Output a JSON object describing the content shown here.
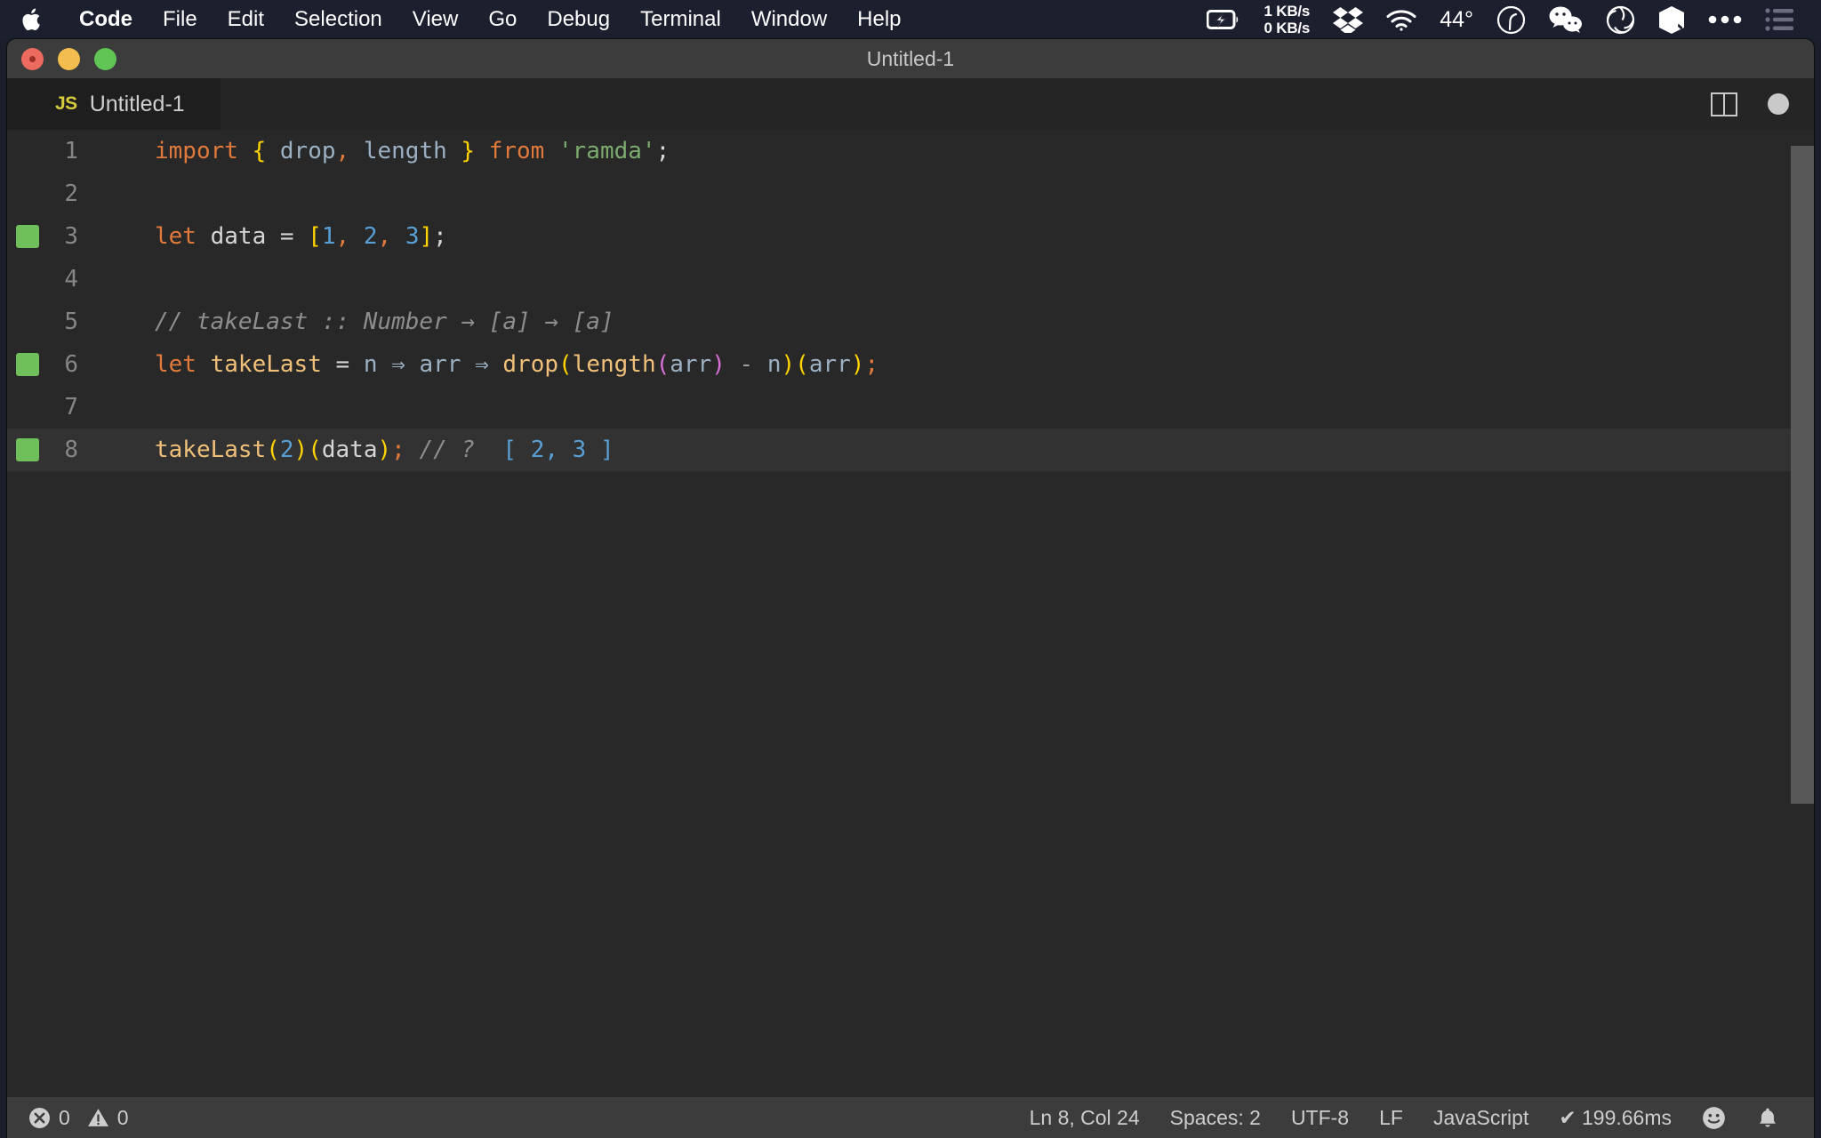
{
  "menubar": {
    "apple_icon": "apple-logo",
    "items": [
      {
        "label": "Code",
        "bold": true
      },
      {
        "label": "File",
        "bold": false
      },
      {
        "label": "Edit",
        "bold": false
      },
      {
        "label": "Selection",
        "bold": false
      },
      {
        "label": "View",
        "bold": false
      },
      {
        "label": "Go",
        "bold": false
      },
      {
        "label": "Debug",
        "bold": false
      },
      {
        "label": "Terminal",
        "bold": false
      },
      {
        "label": "Window",
        "bold": false
      },
      {
        "label": "Help",
        "bold": false
      }
    ],
    "tray": {
      "battery_icon": "battery-charging-icon",
      "network_up": "1 KB/s",
      "network_down": "0 KB/s",
      "dropbox_icon": "dropbox-icon",
      "wifi_icon": "wifi-icon",
      "temperature": "44°",
      "clock_icon": "clock-icon",
      "wechat_icon": "wechat-icon",
      "shutter_icon": "camera-shutter-icon",
      "cube_icon": "cube-icon",
      "overflow_icon": "ellipsis-icon",
      "controlcenter_icon": "list-menu-icon"
    }
  },
  "window": {
    "title": "Untitled-1",
    "traffic": {
      "close": "close-button",
      "minimize": "minimize-button",
      "zoom": "zoom-button"
    }
  },
  "tab": {
    "icon_label": "JS",
    "label": "Untitled-1",
    "split_icon": "split-editor-icon",
    "dirty_icon": "unsaved-dot-icon"
  },
  "editor": {
    "lines": [
      {
        "number": "1",
        "marked": false,
        "active": false,
        "tokens": [
          {
            "t": "import",
            "c": "t-kw"
          },
          {
            "t": " ",
            "c": "t-plain"
          },
          {
            "t": "{",
            "c": "t-brace"
          },
          {
            "t": " ",
            "c": "t-plain"
          },
          {
            "t": "drop",
            "c": "t-var"
          },
          {
            "t": ",",
            "c": "t-comma"
          },
          {
            "t": " ",
            "c": "t-plain"
          },
          {
            "t": "length",
            "c": "t-var"
          },
          {
            "t": " ",
            "c": "t-plain"
          },
          {
            "t": "}",
            "c": "t-brace"
          },
          {
            "t": " ",
            "c": "t-plain"
          },
          {
            "t": "from",
            "c": "t-kw"
          },
          {
            "t": " ",
            "c": "t-plain"
          },
          {
            "t": "'ramda'",
            "c": "t-str"
          },
          {
            "t": ";",
            "c": "t-plain"
          }
        ]
      },
      {
        "number": "2",
        "marked": false,
        "active": false,
        "tokens": []
      },
      {
        "number": "3",
        "marked": true,
        "active": false,
        "tokens": [
          {
            "t": "let",
            "c": "t-kw"
          },
          {
            "t": " ",
            "c": "t-plain"
          },
          {
            "t": "data",
            "c": "t-plain"
          },
          {
            "t": " ",
            "c": "t-plain"
          },
          {
            "t": "=",
            "c": "t-plain"
          },
          {
            "t": " ",
            "c": "t-plain"
          },
          {
            "t": "[",
            "c": "t-brace"
          },
          {
            "t": "1",
            "c": "t-num"
          },
          {
            "t": ",",
            "c": "t-comma"
          },
          {
            "t": " ",
            "c": "t-plain"
          },
          {
            "t": "2",
            "c": "t-num"
          },
          {
            "t": ",",
            "c": "t-comma"
          },
          {
            "t": " ",
            "c": "t-plain"
          },
          {
            "t": "3",
            "c": "t-num"
          },
          {
            "t": "]",
            "c": "t-brace"
          },
          {
            "t": ";",
            "c": "t-plain"
          }
        ]
      },
      {
        "number": "4",
        "marked": false,
        "active": false,
        "tokens": []
      },
      {
        "number": "5",
        "marked": false,
        "active": false,
        "tokens": [
          {
            "t": "// takeLast :: Number → [a] → [a]",
            "c": "t-comment"
          }
        ]
      },
      {
        "number": "6",
        "marked": true,
        "active": false,
        "tokens": [
          {
            "t": "let",
            "c": "t-kw"
          },
          {
            "t": " ",
            "c": "t-plain"
          },
          {
            "t": "takeLast",
            "c": "t-fn"
          },
          {
            "t": " ",
            "c": "t-plain"
          },
          {
            "t": "=",
            "c": "t-plain"
          },
          {
            "t": " ",
            "c": "t-plain"
          },
          {
            "t": "n",
            "c": "t-var"
          },
          {
            "t": " ",
            "c": "t-plain"
          },
          {
            "t": "⇒",
            "c": "t-var"
          },
          {
            "t": " ",
            "c": "t-plain"
          },
          {
            "t": "arr",
            "c": "t-var"
          },
          {
            "t": " ",
            "c": "t-plain"
          },
          {
            "t": "⇒",
            "c": "t-var"
          },
          {
            "t": " ",
            "c": "t-plain"
          },
          {
            "t": "drop",
            "c": "t-fn"
          },
          {
            "t": "(",
            "c": "t-paren-y"
          },
          {
            "t": "length",
            "c": "t-fn"
          },
          {
            "t": "(",
            "c": "t-paren-m"
          },
          {
            "t": "arr",
            "c": "t-var"
          },
          {
            "t": ")",
            "c": "t-paren-m"
          },
          {
            "t": " ",
            "c": "t-plain"
          },
          {
            "t": "-",
            "c": "t-op"
          },
          {
            "t": " ",
            "c": "t-plain"
          },
          {
            "t": "n",
            "c": "t-var"
          },
          {
            "t": ")",
            "c": "t-paren-y"
          },
          {
            "t": "(",
            "c": "t-paren-y"
          },
          {
            "t": "arr",
            "c": "t-var"
          },
          {
            "t": ")",
            "c": "t-paren-y"
          },
          {
            "t": ";",
            "c": "t-semi"
          }
        ]
      },
      {
        "number": "7",
        "marked": false,
        "active": false,
        "tokens": []
      },
      {
        "number": "8",
        "marked": true,
        "active": true,
        "tokens": [
          {
            "t": "takeLast",
            "c": "t-fn"
          },
          {
            "t": "(",
            "c": "t-paren-y"
          },
          {
            "t": "2",
            "c": "t-num"
          },
          {
            "t": ")",
            "c": "t-paren-y"
          },
          {
            "t": "(",
            "c": "t-paren-y"
          },
          {
            "t": "data",
            "c": "t-plain"
          },
          {
            "t": ")",
            "c": "t-paren-y"
          },
          {
            "t": ";",
            "c": "t-semi"
          },
          {
            "t": " ",
            "c": "t-plain"
          },
          {
            "t": "// ?",
            "c": "t-comment"
          },
          {
            "t": "  ",
            "c": "t-plain"
          },
          {
            "t": "[ 2, 3 ]",
            "c": "t-num"
          }
        ]
      }
    ]
  },
  "statusbar": {
    "errors_icon": "error-circle-icon",
    "errors": "0",
    "warnings_icon": "warning-triangle-icon",
    "warnings": "0",
    "cursor": "Ln 8, Col 24",
    "indentation": "Spaces: 2",
    "encoding": "UTF-8",
    "eol": "LF",
    "language": "JavaScript",
    "timing": "✔ 199.66ms",
    "feedback_icon": "smiley-icon",
    "notifications_icon": "bell-icon"
  },
  "colors": {
    "menubar_bg": "#1c1f2e",
    "titlebar_bg": "#3c3c3c",
    "tabbar_bg": "#252526",
    "editor_bg": "#282828",
    "active_line_bg": "#323232",
    "statusbar_bg": "#3c3c3c",
    "gutter_marker": "#6fbf5b",
    "js_yellow": "#d6cc3d"
  }
}
